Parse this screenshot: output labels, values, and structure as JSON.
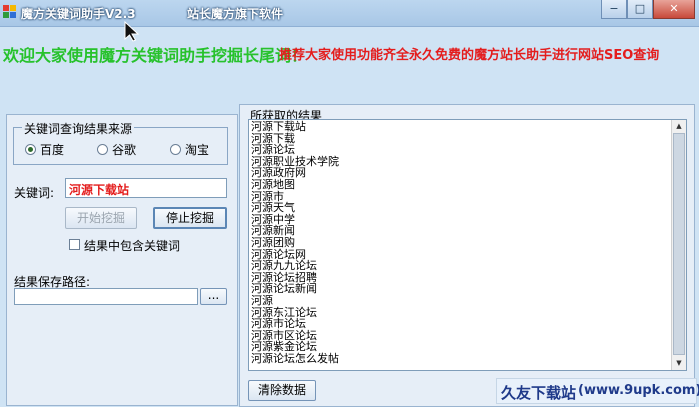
{
  "window": {
    "title": "魔方关键词助手V2.3",
    "subtitle": "站长魔方旗下软件",
    "buttons": {
      "minimize": "−",
      "maximize": "□",
      "close": "✕"
    }
  },
  "banner": {
    "welcome": "欢迎大家使用魔方关键词助手挖掘长尾词！",
    "recommend": "推荐大家使用功能齐全永久免费的魔方站长助手进行网站SEO查询"
  },
  "source_group": {
    "title": "关键词查询结果来源",
    "options": [
      {
        "label": "百度",
        "selected": true
      },
      {
        "label": "谷歌",
        "selected": false
      },
      {
        "label": "淘宝",
        "selected": false
      }
    ]
  },
  "keyword": {
    "label": "关键词:",
    "value": "河源下载站"
  },
  "actions": {
    "start": "开始挖掘",
    "stop": "停止挖掘"
  },
  "include_keyword": {
    "label": "结果中包含关键词",
    "checked": false
  },
  "save_path": {
    "label": "结果保存路径:",
    "value": "",
    "browse": "..."
  },
  "results": {
    "title": "所获取的结果",
    "items": [
      "河源下载站",
      "河源下载",
      "河源论坛",
      "河源职业技术学院",
      "河源政府网",
      "河源地图",
      "河源市",
      "河源天气",
      "河源中学",
      "河源新闻",
      "河源团购",
      "河源论坛网",
      "河源九九论坛",
      "河源论坛招聘",
      "河源论坛新闻",
      "河源",
      "河源东江论坛",
      "河源市论坛",
      "河源市区论坛",
      "河源紫金论坛",
      "河源论坛怎么发帖"
    ],
    "clear": "清除数据"
  },
  "watermark": {
    "cn": "久友下载站",
    "url": "(www.9upk.com)"
  }
}
